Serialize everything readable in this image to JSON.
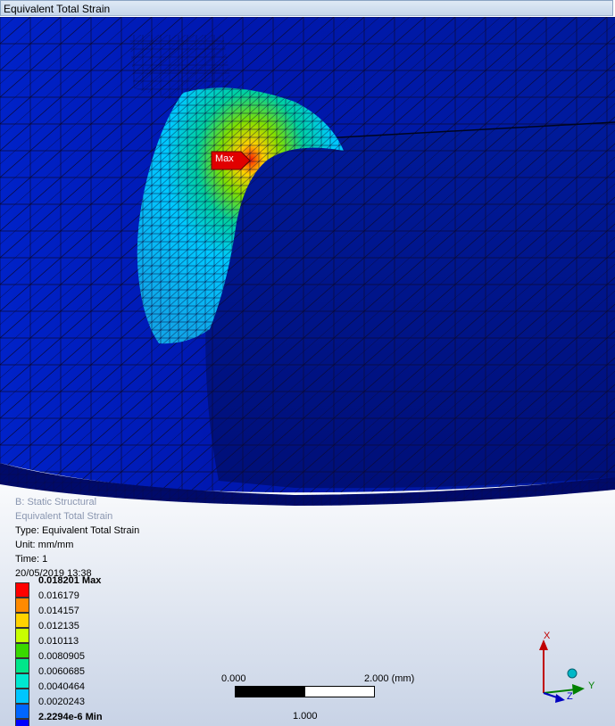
{
  "window": {
    "title": "Equivalent Total Strain"
  },
  "info": {
    "line1": "B: Static Structural",
    "line2": "Equivalent Total Strain",
    "type": "Type: Equivalent Total Strain",
    "unit": "Unit: mm/mm",
    "time": "Time: 1",
    "date": "20/05/2019 13:38"
  },
  "probe": {
    "max_label": "Max"
  },
  "legend": {
    "entries": [
      {
        "label": "0.018201 Max",
        "color": "#ff0000",
        "bold": true
      },
      {
        "label": "0.016179",
        "color": "#ff8a00",
        "bold": false
      },
      {
        "label": "0.014157",
        "color": "#ffd200",
        "bold": false
      },
      {
        "label": "0.012135",
        "color": "#c8ff00",
        "bold": false
      },
      {
        "label": "0.010113",
        "color": "#39d800",
        "bold": false
      },
      {
        "label": "0.0080905",
        "color": "#00e68a",
        "bold": false
      },
      {
        "label": "0.0060685",
        "color": "#00e8d0",
        "bold": false
      },
      {
        "label": "0.0040464",
        "color": "#00c6ff",
        "bold": false
      },
      {
        "label": "0.0020243",
        "color": "#0066ff",
        "bold": false
      },
      {
        "label": "2.2294e-6 Min",
        "color": "#0000ff",
        "bold": true
      }
    ]
  },
  "scale_bar": {
    "left": "0.000",
    "right": "2.000 (mm)",
    "mid": "1.000"
  },
  "triad": {
    "x": "X",
    "y": "Y",
    "z": "Z"
  }
}
